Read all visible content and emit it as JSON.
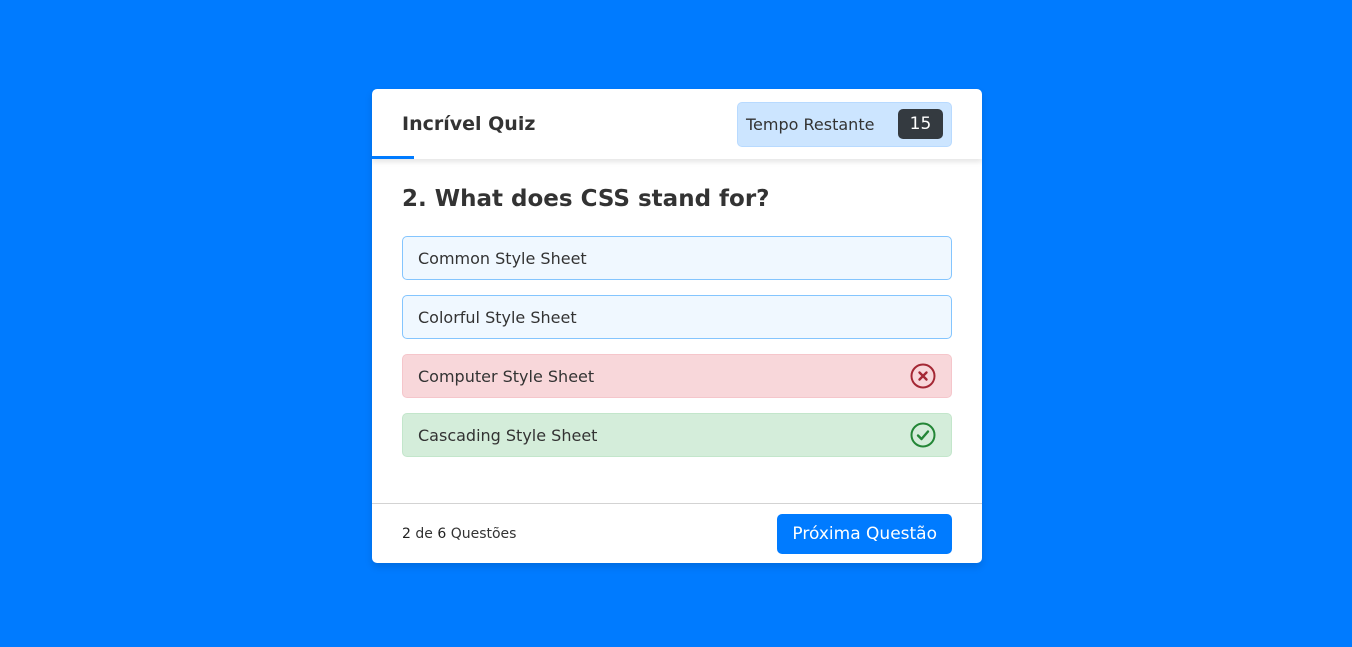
{
  "header": {
    "title": "Incrível Quiz",
    "timer_label": "Tempo Restante",
    "timer_seconds": "15"
  },
  "question": {
    "text": "2. What does CSS stand for?"
  },
  "options": [
    {
      "label": "Common Style Sheet",
      "state": "neutral"
    },
    {
      "label": "Colorful Style Sheet",
      "state": "neutral"
    },
    {
      "label": "Computer Style Sheet",
      "state": "incorrect",
      "icon": "cross-circle-icon"
    },
    {
      "label": "Cascading Style Sheet",
      "state": "correct",
      "icon": "check-circle-icon"
    }
  ],
  "footer": {
    "current": "2",
    "of_text": "de",
    "total": "6",
    "questions_text": "Questões",
    "next_label": "Próxima Questão"
  },
  "colors": {
    "background": "#007bff",
    "accent": "#007bff",
    "correct": "#28a745",
    "incorrect": "#a42834"
  }
}
